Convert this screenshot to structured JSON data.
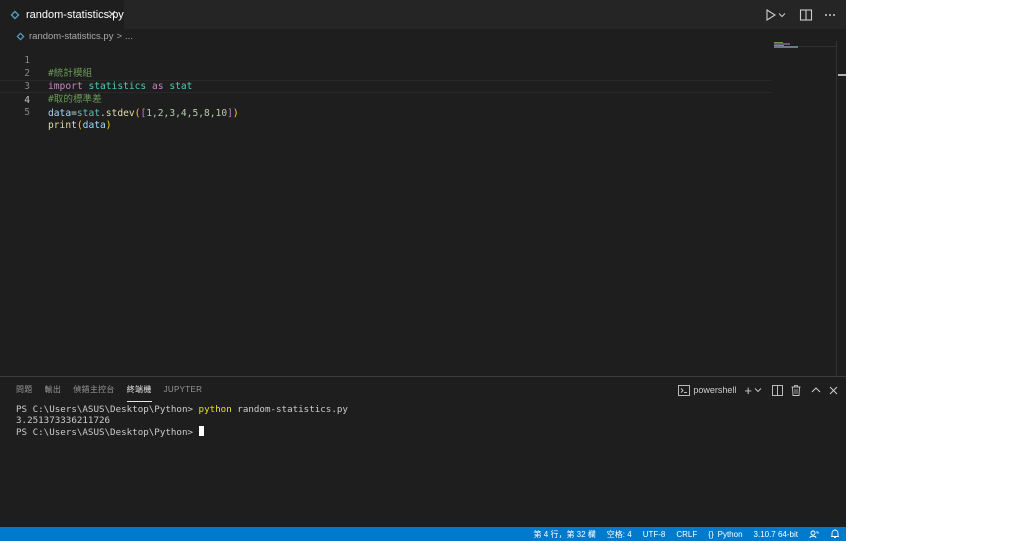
{
  "tab": {
    "filename": "random-statistics.py"
  },
  "breadcrumb": {
    "file": "random-statistics.py",
    "sep": ">",
    "more": "..."
  },
  "editor": {
    "line_numbers": [
      "1",
      "2",
      "3",
      "4",
      "5"
    ],
    "lines": [
      {
        "tokens": [
          "#統計模組"
        ]
      },
      {
        "tokens": [
          "import",
          " ",
          "statistics",
          " ",
          "as",
          " ",
          "stat"
        ]
      },
      {
        "tokens": [
          "#取的標準差"
        ]
      },
      {
        "tokens": [
          "data",
          "=",
          "stat",
          ".",
          "stdev",
          "(",
          "[",
          "1,2,3,4,5,8,10",
          "]",
          ")"
        ]
      },
      {
        "tokens": [
          "print",
          "(",
          "data",
          ")"
        ]
      }
    ],
    "active_line": 4
  },
  "panel": {
    "tabs": [
      "問題",
      "輸出",
      "偵錯主控台",
      "終端機",
      "JUPYTER"
    ],
    "active_tab": "終端機",
    "shell_label": "powershell",
    "plus_label": "+"
  },
  "terminal": {
    "line1_prompt": "PS C:\\Users\\ASUS\\Desktop\\Python> ",
    "line1_cmd": "python",
    "line1_args": " random-statistics.py",
    "line2": "3.251373336211726",
    "line3_prompt": "PS C:\\Users\\ASUS\\Desktop\\Python> "
  },
  "statusbar": {
    "position": "第 4 行，第 32 欄",
    "spaces": "空格: 4",
    "encoding": "UTF-8",
    "eol": "CRLF",
    "language": "Python",
    "interpreter": "3.10.7 64-bit"
  },
  "colors": {
    "accent": "#007acc",
    "editor_bg": "#1e1e1e",
    "tabbar_bg": "#252526"
  },
  "icons": [
    "python-file-icon",
    "close-icon",
    "run-icon",
    "chevron-down-icon",
    "split-editor-icon",
    "more-icon",
    "terminal-icon",
    "trash-icon",
    "chevron-up-icon",
    "braces-icon",
    "feedback-icon",
    "bell-icon"
  ]
}
